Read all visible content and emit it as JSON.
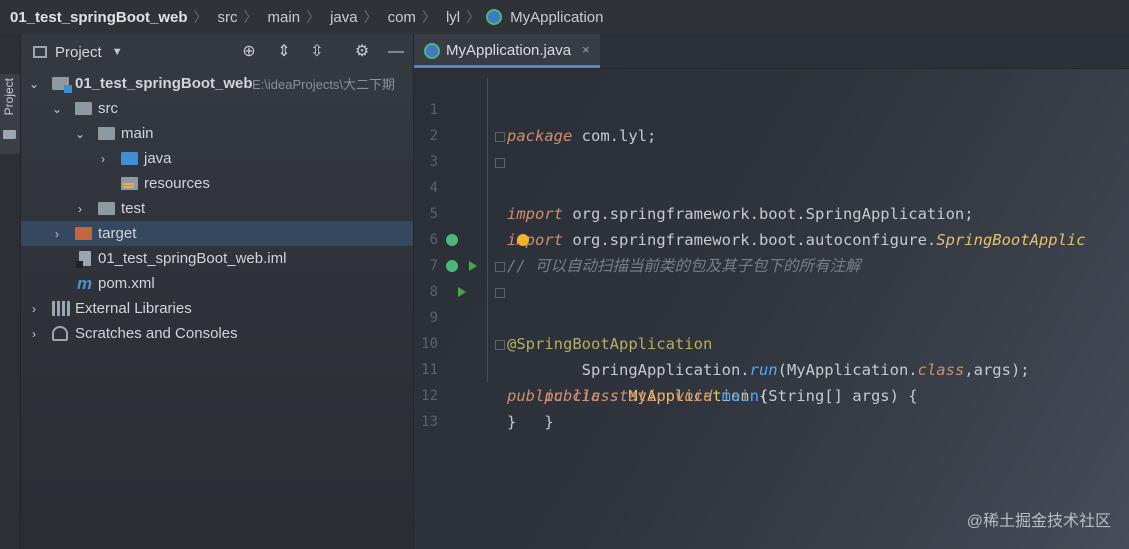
{
  "breadcrumb": {
    "items": [
      "01_test_springBoot_web",
      "src",
      "main",
      "java",
      "com",
      "lyl",
      "MyApplication"
    ],
    "separator": "〉"
  },
  "sidebar": {
    "tab_label": "Project"
  },
  "project_panel": {
    "title": "Project",
    "header_icons": [
      "locate-icon",
      "expand-all-icon",
      "collapse-all-icon",
      "settings-icon",
      "hide-icon"
    ],
    "tree": [
      {
        "label": "01_test_springBoot_web",
        "path": "E:\\ideaProjects\\大二下期",
        "icon": "module-folder-icon",
        "expanded": true
      },
      {
        "label": "src",
        "icon": "folder-icon",
        "expanded": true
      },
      {
        "label": "main",
        "icon": "folder-icon",
        "expanded": true
      },
      {
        "label": "java",
        "icon": "source-folder-icon",
        "expanded": false
      },
      {
        "label": "resources",
        "icon": "resources-folder-icon"
      },
      {
        "label": "test",
        "icon": "folder-icon",
        "expanded": false
      },
      {
        "label": "target",
        "icon": "excluded-folder-icon",
        "expanded": false,
        "selected": true
      },
      {
        "label": "01_test_springBoot_web.iml",
        "icon": "iml-file-icon"
      },
      {
        "label": "pom.xml",
        "icon": "maven-icon"
      },
      {
        "label": "External Libraries",
        "icon": "library-icon",
        "expanded": false
      },
      {
        "label": "Scratches and Consoles",
        "icon": "scratches-icon",
        "expanded": false
      }
    ]
  },
  "editor": {
    "tab": {
      "label": "MyApplication.java",
      "close": "×"
    },
    "lines": [
      {
        "n": "1",
        "text": "package com.lyl;"
      },
      {
        "n": "2",
        "text": ""
      },
      {
        "n": "3",
        "text": "import org.springframework.boot.SpringApplication;"
      },
      {
        "n": "4",
        "text": "import org.springframework.boot.autoconfigure.SpringBootApplic"
      },
      {
        "n": "5",
        "text": ""
      },
      {
        "n": "6",
        "text": "// 可以自动扫描当前类的包及其子包下的所有注解"
      },
      {
        "n": "7",
        "text": "@SpringBootApplication"
      },
      {
        "n": "8",
        "text": "public class MyApplication {"
      },
      {
        "n": "9",
        "text": "    public static void main(String[] args) {"
      },
      {
        "n": "10",
        "text": "        SpringApplication.run(MyApplication.class,args);"
      },
      {
        "n": "11",
        "text": "    }"
      },
      {
        "n": "12",
        "text": "}"
      },
      {
        "n": "13",
        "text": ""
      }
    ]
  },
  "watermark": "@稀土掘金技术社区",
  "colors": {
    "keyword": "#cf8e6d",
    "annotation": "#b3ae60",
    "comment": "#7a7e85",
    "selection": "#36485f",
    "tab_underline": "#4a88c7"
  }
}
